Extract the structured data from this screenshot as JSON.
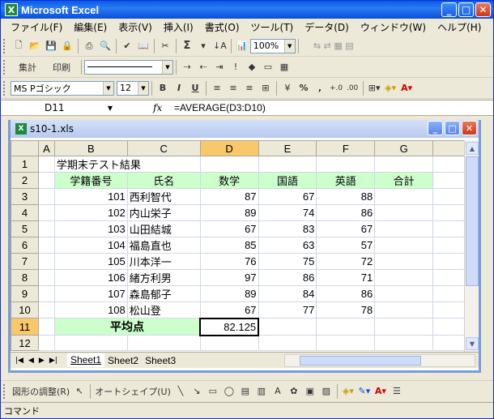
{
  "app": {
    "title": "Microsoft Excel",
    "icon_name": "excel-icon"
  },
  "window_buttons": {
    "minimize": "_",
    "maximize": "□",
    "close": "✕"
  },
  "menu": [
    "ファイル(F)",
    "編集(E)",
    "表示(V)",
    "挿入(I)",
    "書式(O)",
    "ツール(T)",
    "データ(D)",
    "ウィンドウ(W)",
    "ヘルプ(H)"
  ],
  "toolbar_standard": {
    "sum_label": "Σ",
    "zoom": "100%"
  },
  "toolbar_custom": {
    "total_label": "集計",
    "print_label": "印刷"
  },
  "toolbar_format": {
    "font_name": "MS Pゴシック",
    "font_size": "12",
    "bold": "B",
    "italic": "I",
    "underline": "U",
    "percent": "%",
    "comma": ",",
    "inc_decimal": "+.0",
    "dec_decimal": ".00"
  },
  "formula_bar": {
    "cell_ref": "D11",
    "fx": "fx",
    "formula": "=AVERAGE(D3:D10)"
  },
  "document": {
    "filename": "s10-1.xls"
  },
  "sheet": {
    "columns": [
      "A",
      "B",
      "C",
      "D",
      "E",
      "F",
      "G"
    ],
    "active_column": "D",
    "active_row": "11",
    "title": "学期末テスト結果",
    "headers": [
      "学籍番号",
      "氏名",
      "数学",
      "国語",
      "英語",
      "合計"
    ],
    "rows": [
      {
        "row": "3",
        "id": "101",
        "name": "西利智代",
        "math": "87",
        "jp": "67",
        "en": "88"
      },
      {
        "row": "4",
        "id": "102",
        "name": "内山栄子",
        "math": "89",
        "jp": "74",
        "en": "86"
      },
      {
        "row": "5",
        "id": "103",
        "name": "山田結城",
        "math": "67",
        "jp": "83",
        "en": "67"
      },
      {
        "row": "6",
        "id": "104",
        "name": "福島直也",
        "math": "85",
        "jp": "63",
        "en": "57"
      },
      {
        "row": "7",
        "id": "105",
        "name": "川本洋一",
        "math": "76",
        "jp": "75",
        "en": "72"
      },
      {
        "row": "8",
        "id": "106",
        "name": "緒方利男",
        "math": "97",
        "jp": "86",
        "en": "71"
      },
      {
        "row": "9",
        "id": "107",
        "name": "森島郁子",
        "math": "89",
        "jp": "84",
        "en": "86"
      },
      {
        "row": "10",
        "id": "108",
        "name": "松山登",
        "math": "67",
        "jp": "77",
        "en": "78"
      }
    ],
    "average_label": "平均点",
    "average_math": "82.125"
  },
  "sheet_tabs": [
    "Sheet1",
    "Sheet2",
    "Sheet3"
  ],
  "drawing_toolbar": {
    "adjust_label": "図形の調整(R)",
    "autoshape_label": "オートシェイプ(U)"
  },
  "status": {
    "text": "コマンド"
  }
}
